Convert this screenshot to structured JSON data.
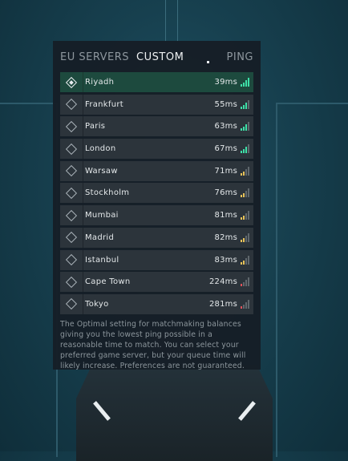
{
  "header": {
    "tabs": [
      {
        "label": "EU SERVERS",
        "active": false
      },
      {
        "label": "CUSTOM",
        "active": true
      }
    ],
    "ping_label": "PING"
  },
  "servers": [
    {
      "name": "Riyadh",
      "ping": "39ms",
      "signal": 4,
      "quality": "good",
      "selected": true
    },
    {
      "name": "Frankfurt",
      "ping": "55ms",
      "signal": 3,
      "quality": "good",
      "selected": false
    },
    {
      "name": "Paris",
      "ping": "63ms",
      "signal": 3,
      "quality": "good",
      "selected": false
    },
    {
      "name": "London",
      "ping": "67ms",
      "signal": 3,
      "quality": "good",
      "selected": false
    },
    {
      "name": "Warsaw",
      "ping": "71ms",
      "signal": 2,
      "quality": "medium",
      "selected": false
    },
    {
      "name": "Stockholm",
      "ping": "76ms",
      "signal": 2,
      "quality": "medium",
      "selected": false
    },
    {
      "name": "Mumbai",
      "ping": "81ms",
      "signal": 2,
      "quality": "medium",
      "selected": false
    },
    {
      "name": "Madrid",
      "ping": "82ms",
      "signal": 2,
      "quality": "medium",
      "selected": false
    },
    {
      "name": "Istanbul",
      "ping": "83ms",
      "signal": 2,
      "quality": "medium",
      "selected": false
    },
    {
      "name": "Cape Town",
      "ping": "224ms",
      "signal": 1,
      "quality": "poor",
      "selected": false
    },
    {
      "name": "Tokyo",
      "ping": "281ms",
      "signal": 1,
      "quality": "poor",
      "selected": false
    }
  ],
  "footnote": "The Optimal setting for matchmaking balances giving you the lowest ping possible in a reasonable time to match. You can select your preferred game server, but your queue time will likely increase. Preferences are not guaranteed.",
  "colors": {
    "good": "#3ee0a8",
    "medium": "#e6c25a",
    "poor": "#e2525a",
    "inactive_bar": "#5f676c",
    "selected_row": "#1d4a3e"
  }
}
